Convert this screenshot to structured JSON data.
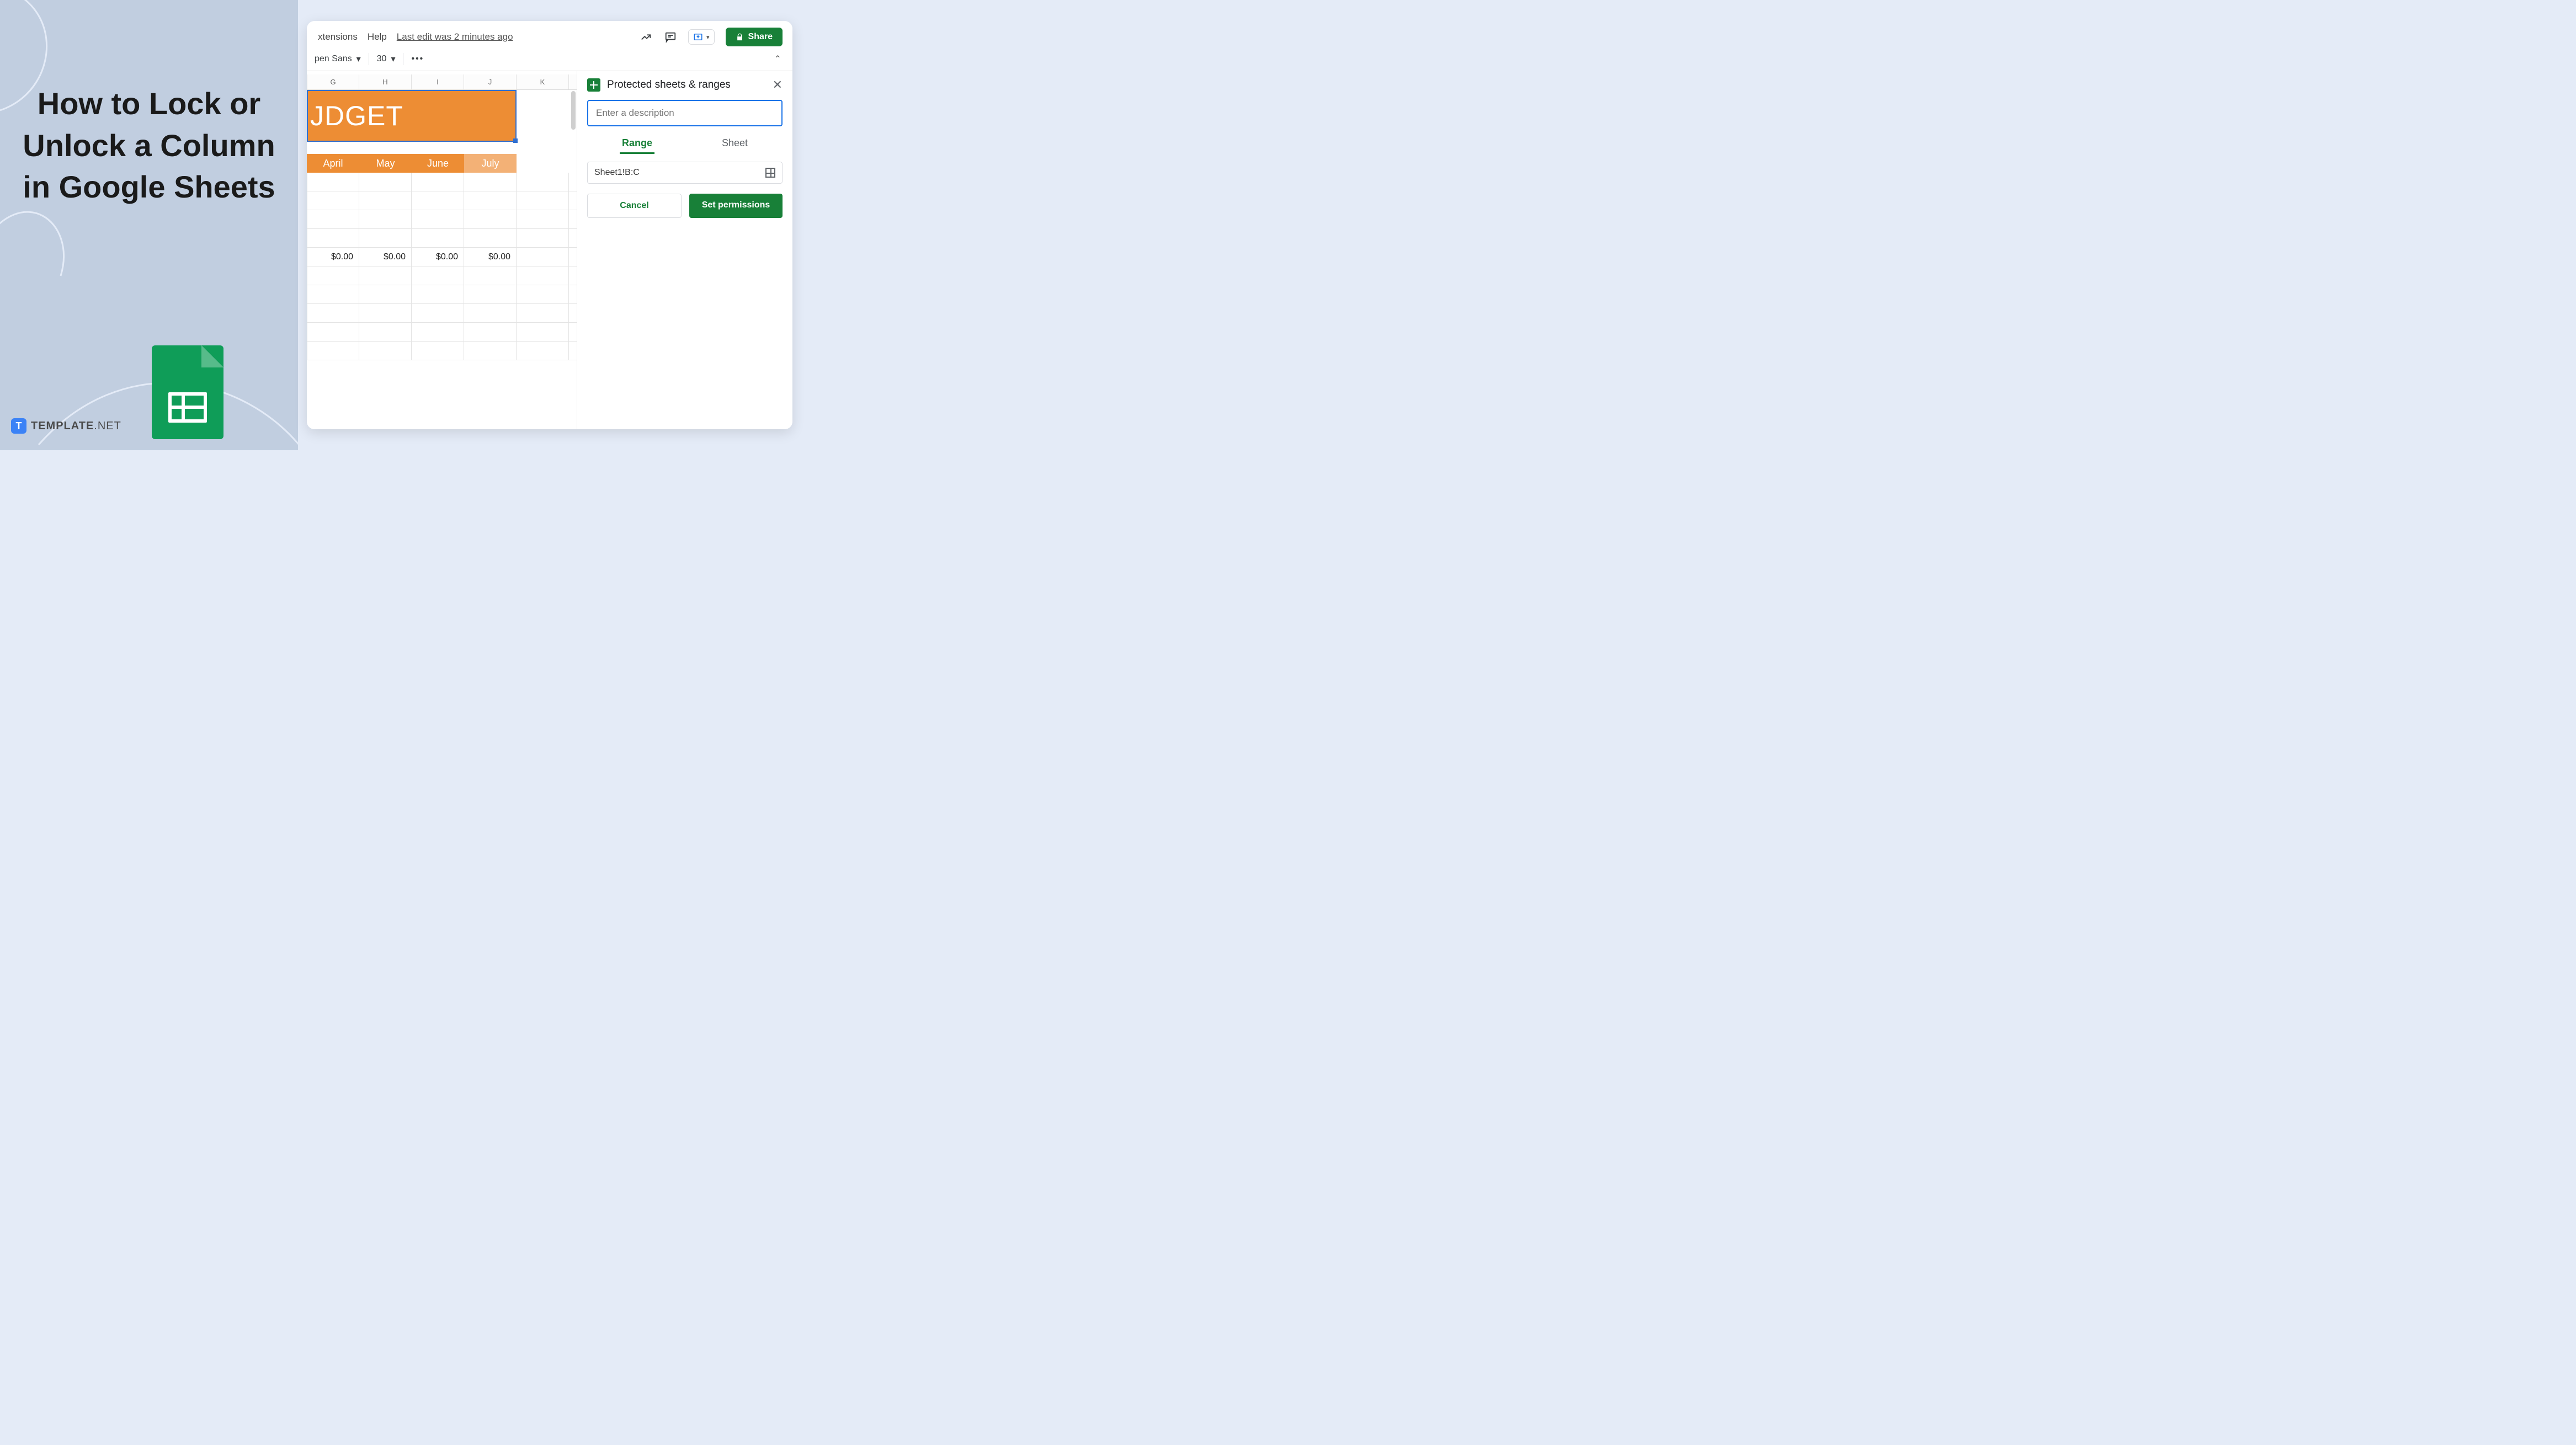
{
  "left": {
    "title": "How to Lock or Unlock a Column in Google Sheets",
    "brand_letter": "T",
    "brand_main": "TEMPLATE",
    "brand_suffix": ".NET"
  },
  "menu": {
    "extensions": "xtensions",
    "help": "Help",
    "last_edit": "Last edit was 2 minutes ago"
  },
  "share_label": "Share",
  "toolbar": {
    "font": "pen Sans",
    "size": "30"
  },
  "columns": [
    "G",
    "H",
    "I",
    "J",
    "K"
  ],
  "banner_text": "JDGET",
  "months": [
    "April",
    "May",
    "June",
    "July"
  ],
  "money_row": [
    "$0.00",
    "$0.00",
    "$0.00",
    "$0.00",
    ""
  ],
  "panel": {
    "title": "Protected sheets & ranges",
    "placeholder": "Enter a description",
    "tab_range": "Range",
    "tab_sheet": "Sheet",
    "range_value": "Sheet1!B:C",
    "cancel": "Cancel",
    "set": "Set permissions"
  }
}
